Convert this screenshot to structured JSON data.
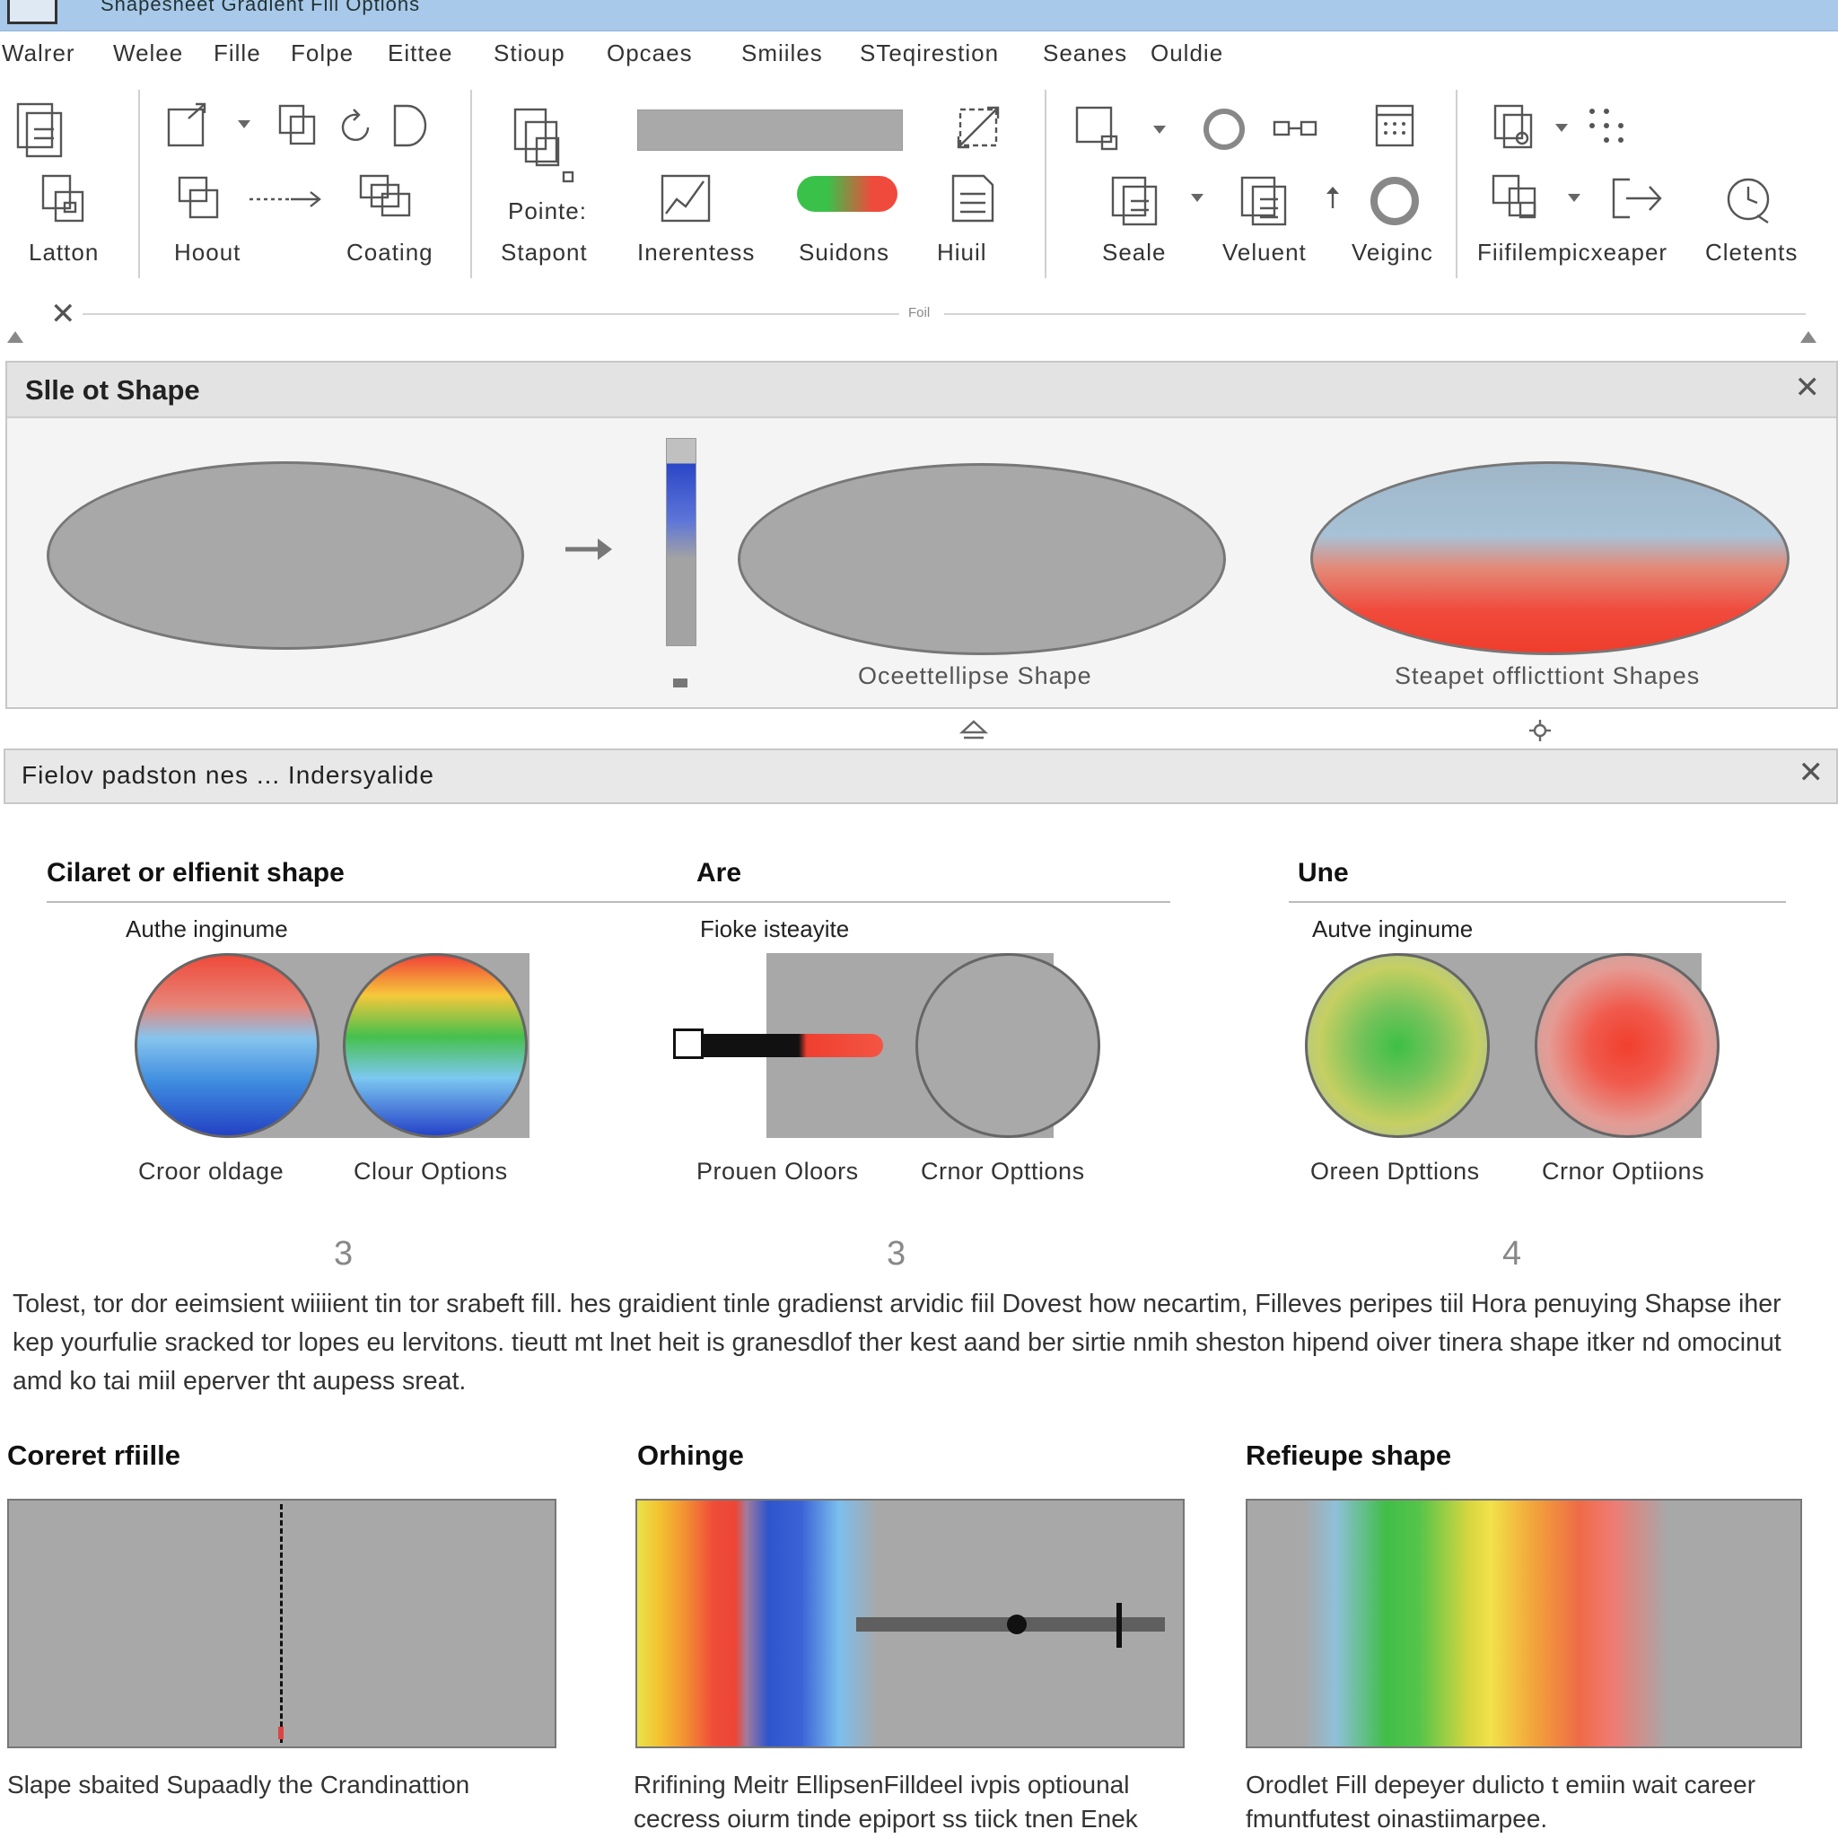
{
  "window": {
    "title": "Shapesheet Gradient Fill Options"
  },
  "menu": [
    "Walrer",
    "Welee",
    "Fille",
    "Folpe",
    "Eittee",
    "Stioup",
    "Opcaes",
    "Smiiles",
    "STeqirestion",
    "Seanes",
    "Ouldie"
  ],
  "ribbon": {
    "labels": {
      "latton": "Latton",
      "hoout": "Hoout",
      "coating": "Coating",
      "pointer": "Pointe:",
      "stapont": "Stapont",
      "inerentess": "Inerentess",
      "suidons": "Suidons",
      "hiuil": "Hiuil",
      "seale": "Seale",
      "veluent": "Veluent",
      "veiginc": "Veiginc",
      "filemp": "Fiifilempicxeaper",
      "cletents": "Cletents"
    },
    "divider_label": "Foil",
    "colors": {
      "accent_green": "#3ac14a",
      "accent_red": "#f04a3c"
    }
  },
  "panel1": {
    "title": "Slle ot Shape",
    "captions": {
      "middle": "Oceettellipse Shape",
      "right": "Steapet offlicttiont Shapes"
    }
  },
  "panel2": {
    "title": "Fielov padston nes ... Indersyalide"
  },
  "sections": [
    {
      "title": "Cilaret or elfienit shape",
      "sub": "Authe inginume",
      "labels": [
        "Croor oldage",
        "Clour Options"
      ],
      "num": "3"
    },
    {
      "title": "Are",
      "sub": "Fioke isteayite",
      "labels": [
        "Prouen Oloors",
        "Crnor Opttions"
      ],
      "num": "3"
    },
    {
      "title": "Une",
      "sub": "Autve inginume",
      "labels": [
        "Oreen Dpttions",
        "Crnor Optiions"
      ],
      "num": "4"
    }
  ],
  "paragraph": "Tolest, tor dor eeimsient wiiiient tin tor srabeft fill. hes graidient tinle gradienst arvidic fiil  Dovest  how necartim, Filleves peripes tiil Hora penuying Shapse iher kep yourfulie sracked tor lopes eu lervitons. tieutt mt lnet heit is granesdlof ther kest  aand ber sirtie nmih sheston hipend oiver tinera shape itker nd omocinut amd ko tai miil eperver tht aupess sreat.",
  "bottom": [
    {
      "title": "Coreret rfiille",
      "caption": "Slape sbaited Supaadly the Crandinattion"
    },
    {
      "title": "Orhinge",
      "caption": "Rrifining Meitr EllipsenFilldeel ivpis optiounal cecress oiurm tinde epiport ss tiick tnen Enek"
    },
    {
      "title": "Refieupe shape",
      "caption": "Orodlet Fill depeyer dulicto t emiin wait career fmuntfutest oinastiimarpee."
    }
  ],
  "slider": {
    "value": 0.52
  }
}
